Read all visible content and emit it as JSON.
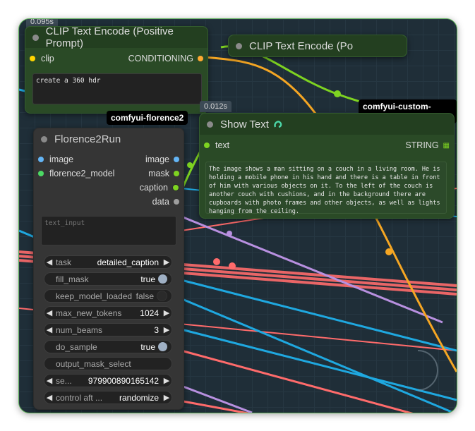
{
  "clip_node": {
    "time": "0.095s",
    "title": "CLIP Text Encode (Positive Prompt)",
    "input_label": "clip",
    "output_label": "CONDITIONING",
    "text_value": "create a 360 hdr"
  },
  "clip_node_2": {
    "title": "CLIP Text Encode (Po"
  },
  "badges": {
    "florence": "comfyui-florence2",
    "custom_scripts": "comfyui-custom-scripts"
  },
  "show_text": {
    "time": "0.012s",
    "title": "Show Text",
    "title_icon": "snake-icon",
    "input_label": "text",
    "output_label": "STRING",
    "output_icon": "grid-icon",
    "text_value": "The image shows a man sitting on a couch in a living room. He is holding a mobile phone in his hand and there is a table in front of him with various objects on it. To the left of the couch is another couch with cushions, and in the background there are cupboards with photo frames and other objects, as well as lights hanging from the ceiling."
  },
  "florence": {
    "title": "Florence2Run",
    "inputs": [
      "image",
      "florence2_model"
    ],
    "outputs": [
      "image",
      "mask",
      "caption",
      "data"
    ],
    "text_input_placeholder": "text_input",
    "widgets": {
      "task": {
        "label": "task",
        "value": "detailed_caption"
      },
      "fill_mask": {
        "label": "fill_mask",
        "value": "true"
      },
      "keep_model_loaded": {
        "label": "keep_model_loaded",
        "value": "false"
      },
      "max_new_tokens": {
        "label": "max_new_tokens",
        "value": "1024"
      },
      "num_beams": {
        "label": "num_beams",
        "value": "3"
      },
      "do_sample": {
        "label": "do_sample",
        "value": "true"
      },
      "output_mask_select": {
        "label": "output_mask_select"
      },
      "seed": {
        "label": "se...",
        "value": "979900890165142"
      },
      "control_after": {
        "label": "control aft ...",
        "value": "randomize"
      }
    }
  },
  "colors": {
    "canvas": "#1f2e38",
    "link_green": "#7ed321",
    "link_orange": "#f5a623",
    "link_red": "#ff6b6b",
    "link_blue": "#1fa8e0",
    "link_purple": "#b890e0",
    "clip_slot": "#ffd500",
    "conditioning_slot": "#ffa931",
    "image_slot": "#64b5f6",
    "model_slot": "#4cd964",
    "text_slot": "#7ed321"
  }
}
